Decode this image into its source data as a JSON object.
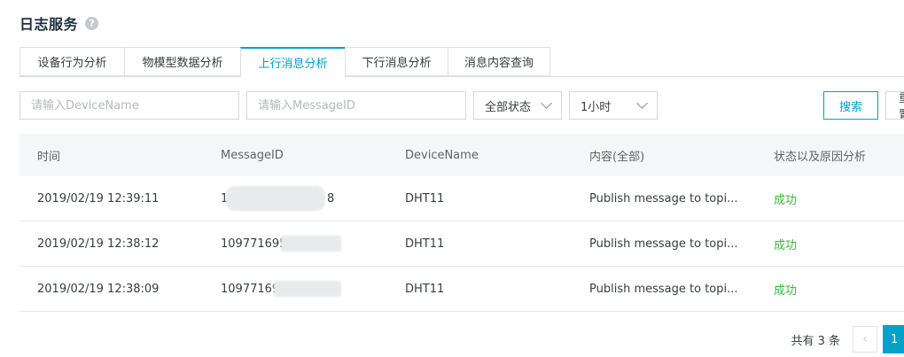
{
  "header": {
    "title": "日志服务",
    "help_icon": "question-icon",
    "help_glyph": "?"
  },
  "tabs": [
    {
      "label": "设备行为分析",
      "active": false
    },
    {
      "label": "物模型数据分析",
      "active": false
    },
    {
      "label": "上行消息分析",
      "active": true
    },
    {
      "label": "下行消息分析",
      "active": false
    },
    {
      "label": "消息内容查询",
      "active": false
    }
  ],
  "filters": {
    "device_name_placeholder": "请输入DeviceName",
    "message_id_placeholder": "请输入MessageID",
    "status_value": "全部状态",
    "time_value": "1小时",
    "search_label": "搜索",
    "reset_label": "重置"
  },
  "table": {
    "headers": [
      "时间",
      "MessageID",
      "DeviceName",
      "内容(全部)",
      "状态以及原因分析"
    ],
    "rows": [
      {
        "time": "2019/02/19 12:39:11",
        "message_id": "1",
        "message_id_tail": "8",
        "device": "DHT11",
        "content": "Publish message to topi...",
        "status": "成功"
      },
      {
        "time": "2019/02/19 12:38:12",
        "message_id": "109771695",
        "message_id_tail": "",
        "device": "DHT11",
        "content": "Publish message to topi...",
        "status": "成功"
      },
      {
        "time": "2019/02/19 12:38:09",
        "message_id": "10977169",
        "message_id_tail": "",
        "device": "DHT11",
        "content": "Publish message to topi...",
        "status": "成功"
      }
    ]
  },
  "pagination": {
    "total_text": "共有 3 条",
    "current_page": "1",
    "prev_glyph": "‹"
  },
  "colors": {
    "accent": "#00a2ca",
    "success": "#3ab73a",
    "header_bg": "#f5f6f7"
  }
}
